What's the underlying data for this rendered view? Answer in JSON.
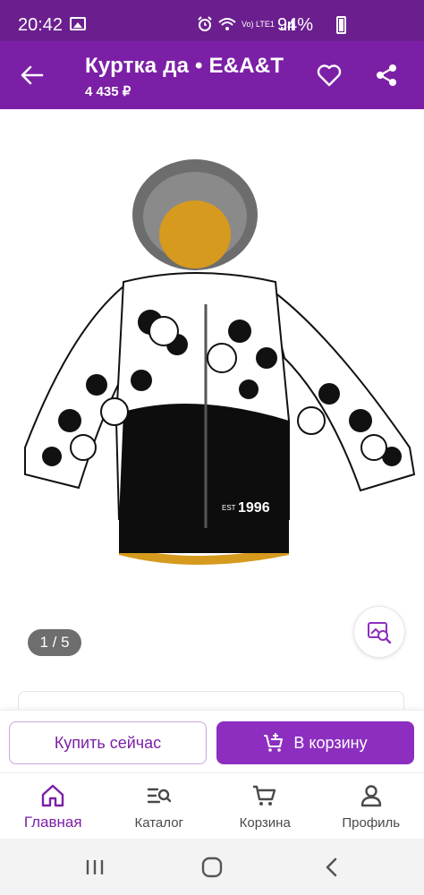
{
  "status_bar": {
    "time": "20:42",
    "network": "Vo) LTE1",
    "battery": "94%"
  },
  "app_bar": {
    "title": "Куртка да • E&A&T",
    "price": "4 435 ₽",
    "icons": [
      "arrow-left-icon",
      "heart-icon",
      "share-icon"
    ]
  },
  "gallery": {
    "counter": "1 / 5",
    "image_text": "1996",
    "image_text_small": "EST",
    "search_icon": "image-search-icon"
  },
  "actions": {
    "buy_now": "Купить сейчас",
    "add_to_cart": "В корзину"
  },
  "bottom_nav": {
    "items": [
      {
        "label": "Главная",
        "icon": "home-icon",
        "active": true
      },
      {
        "label": "Каталог",
        "icon": "catalog-icon",
        "active": false
      },
      {
        "label": "Корзина",
        "icon": "cart-icon",
        "active": false
      },
      {
        "label": "Профиль",
        "icon": "profile-icon",
        "active": false
      }
    ]
  },
  "colors": {
    "status_bar": "#6b1f8f",
    "app_bar": "#7b20a6",
    "accent": "#8d2ec0"
  }
}
